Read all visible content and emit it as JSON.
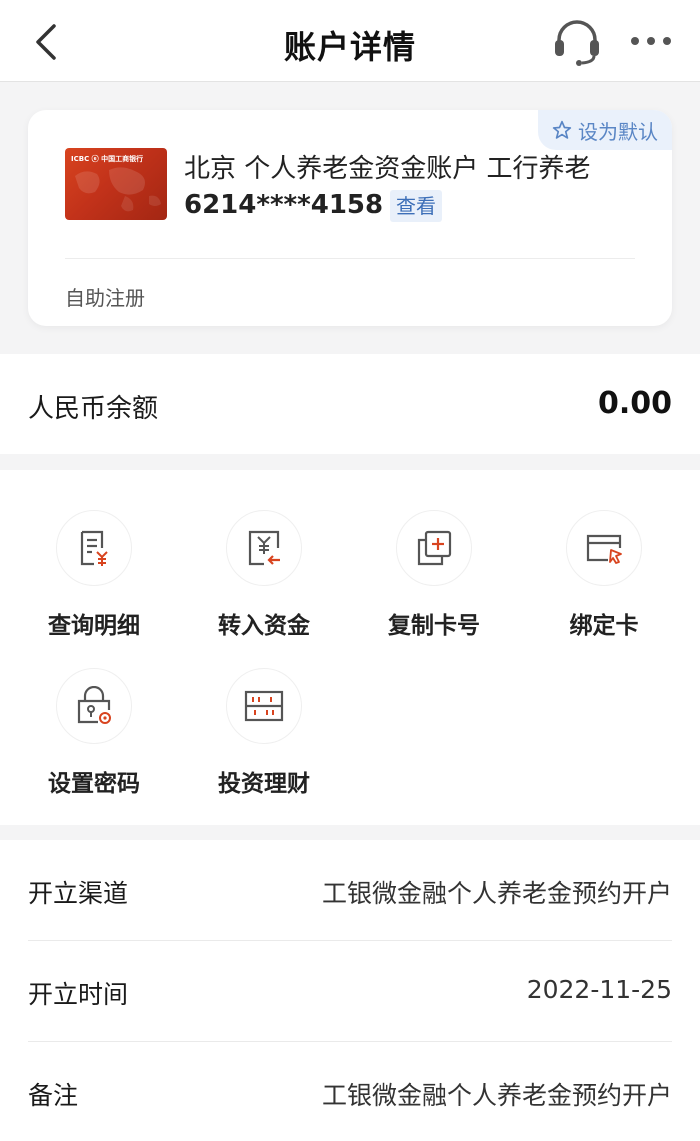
{
  "header": {
    "title": "账户详情",
    "back_icon": "chevron-left-icon",
    "service_icon": "headset-icon",
    "more_icon": "more-dots-icon"
  },
  "card": {
    "default_label": "设为默认",
    "account_name": "北京 个人养老金资金账户  工行养老",
    "account_number": "6214****4158",
    "view_label": "查看",
    "registration": "自助注册",
    "card_logo_text": "ICBC ⓔ 中国工商银行"
  },
  "balance": {
    "label": "人民币余额",
    "value": "0.00"
  },
  "functions": [
    {
      "label": "查询明细",
      "icon": "statement-icon"
    },
    {
      "label": "转入资金",
      "icon": "transfer-in-icon"
    },
    {
      "label": "复制卡号",
      "icon": "copy-icon"
    },
    {
      "label": "绑定卡",
      "icon": "bind-card-icon"
    },
    {
      "label": "设置密码",
      "icon": "password-lock-icon"
    },
    {
      "label": "投资理财",
      "icon": "abacus-icon"
    }
  ],
  "details": [
    {
      "label": "开立渠道",
      "value": "工银微金融个人养老金预约开户"
    },
    {
      "label": "开立时间",
      "value": "2022-11-25"
    },
    {
      "label": "备注",
      "value": "工银微金融个人养老金预约开户"
    }
  ],
  "colors": {
    "accent": "#3d6fb8",
    "icon_red": "#d8441f",
    "icon_gray": "#555555",
    "background": "#f4f4f5"
  }
}
